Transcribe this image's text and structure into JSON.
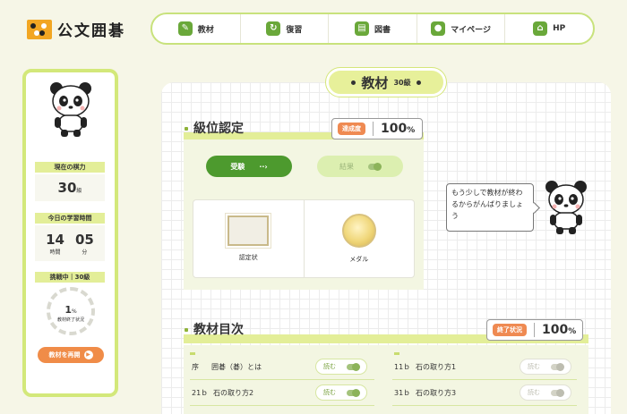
{
  "header": {
    "logo_text": "公文囲碁",
    "nav": [
      {
        "label": "教材",
        "icon": "pencil-icon"
      },
      {
        "label": "復習",
        "icon": "refresh-icon"
      },
      {
        "label": "図書",
        "icon": "book-icon"
      },
      {
        "label": "マイページ",
        "icon": "panda-face-icon"
      },
      {
        "label": "HP",
        "icon": "house-icon"
      }
    ]
  },
  "sidebar": {
    "rank_label": "現在の棋力",
    "rank_value": "30",
    "rank_unit": "級",
    "study_label": "今日の学習時間",
    "hours": "14",
    "hours_unit": "時間",
    "minutes": "05",
    "minutes_unit": "分",
    "challenge_label": "挑戦中｜30級",
    "progress_value": "1",
    "progress_unit": "%",
    "progress_label": "教材終了状況",
    "progress_fraction": 0.01,
    "resume_label": "教材を再開"
  },
  "main": {
    "title": "教材",
    "level": "30級",
    "cert": {
      "title": "級位認定",
      "badge": "達成度",
      "percent": "100",
      "percent_unit": "%",
      "take_label": "受験",
      "result_label": "結果",
      "card_cert": "認定状",
      "card_medal": "メダル"
    },
    "speech": "もう少しで教材が終わるからがんばりましょう",
    "toc": {
      "title": "教材目次",
      "badge": "終了状況",
      "percent": "100",
      "percent_unit": "%",
      "read_label": "読む",
      "rows": [
        {
          "num": "序",
          "name": "囲碁（碁）とは"
        },
        {
          "num": "11ｂ",
          "name": "石の取り方1"
        },
        {
          "num": "21ｂ",
          "name": "石の取り方2"
        },
        {
          "num": "31ｂ",
          "name": "石の取り方3"
        }
      ]
    }
  },
  "colors": {
    "accent_green": "#4d9a2e",
    "lime": "#d3e87a",
    "orange": "#ef8a52"
  }
}
